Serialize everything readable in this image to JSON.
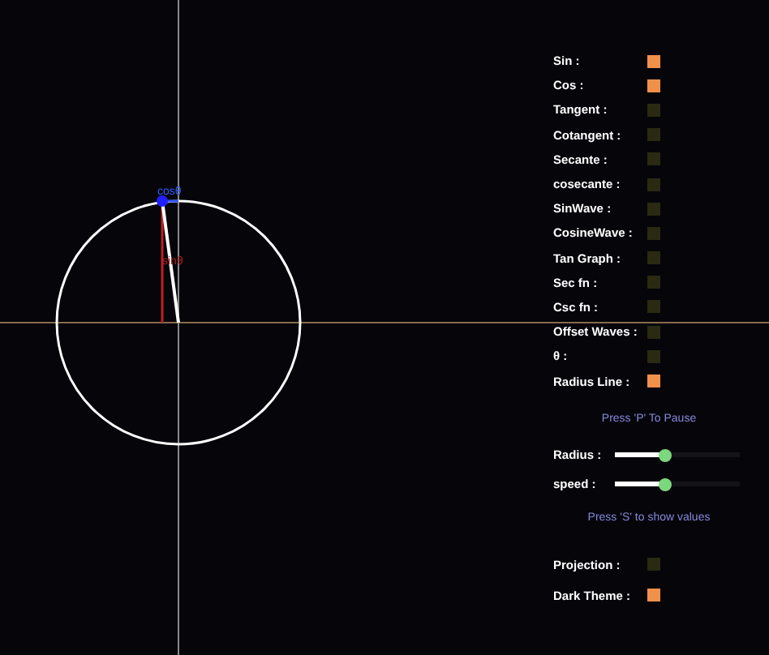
{
  "canvas": {
    "cos_label": "cosθ",
    "sin_label": "sinθ"
  },
  "toggles": [
    {
      "label": "Sin :",
      "checked": true
    },
    {
      "label": "Cos :",
      "checked": true
    },
    {
      "label": "Tangent :",
      "checked": false
    },
    {
      "label": "Cotangent :",
      "checked": false
    },
    {
      "label": "Secante :",
      "checked": false
    },
    {
      "label": "cosecante :",
      "checked": false
    },
    {
      "label": "SinWave :",
      "checked": false
    },
    {
      "label": "CosineWave :",
      "checked": false
    },
    {
      "label": "Tan Graph :",
      "checked": false
    },
    {
      "label": "Sec fn :",
      "checked": false
    },
    {
      "label": "Csc fn :",
      "checked": false
    },
    {
      "label": "Offset Waves :",
      "checked": false
    },
    {
      "label": "θ :",
      "checked": false
    },
    {
      "label": "Radius Line :",
      "checked": true
    }
  ],
  "pause_hint": "Press 'P' To Pause",
  "sliders": [
    {
      "label": "Radius :",
      "level": 0.4
    },
    {
      "label": "speed :",
      "level": 0.4
    }
  ],
  "values_hint": "Press 'S' to show values",
  "options": [
    {
      "label": "Projection :",
      "checked": false
    },
    {
      "label": "Dark Theme :",
      "checked": true
    }
  ]
}
